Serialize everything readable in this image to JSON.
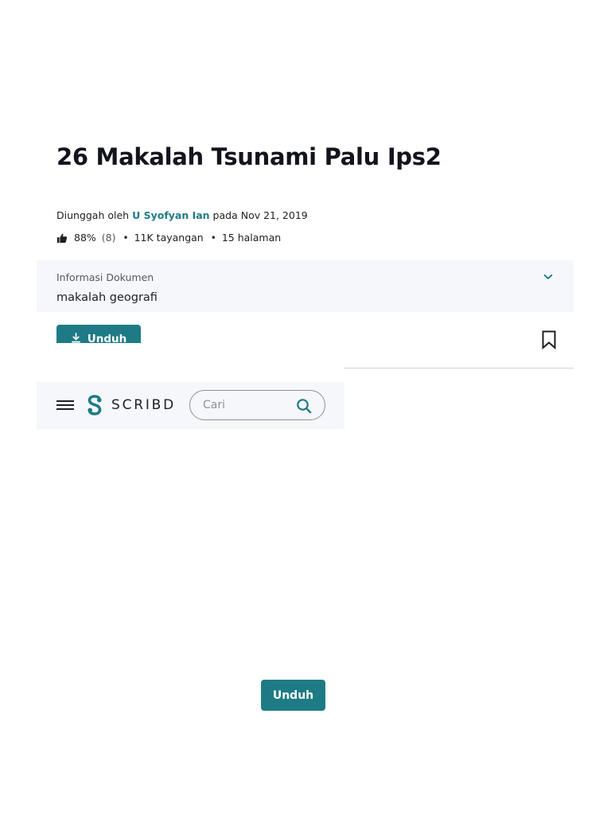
{
  "document": {
    "title": "26 Makalah Tsunami Palu Ips2",
    "upload_prefix": "Diunggah oleh ",
    "author": "U Syofyan Ian",
    "upload_suffix": " pada Nov 21, 2019",
    "rating_percent": "88%",
    "rating_count": "(8)",
    "views": "11K tayangan",
    "pages": "15 halaman"
  },
  "info_panel": {
    "label": "Informasi Dokumen",
    "value": "makalah geografi"
  },
  "actions": {
    "download_label": "Unduh",
    "download_bottom_label": "Unduh"
  },
  "header": {
    "logo_text": "SCRIBD",
    "search_placeholder": "Cari"
  },
  "colors": {
    "accent": "#1e7b85",
    "panel_bg": "#f6f7fb",
    "text": "#1e1e24"
  },
  "icons": {
    "rating": "thumbs-up-icon",
    "info_toggle": "chevron-down-icon",
    "download": "download-icon",
    "save": "bookmark-icon",
    "menu": "hamburger-menu-icon",
    "search": "search-icon",
    "brand": "scribd-logo-icon"
  }
}
